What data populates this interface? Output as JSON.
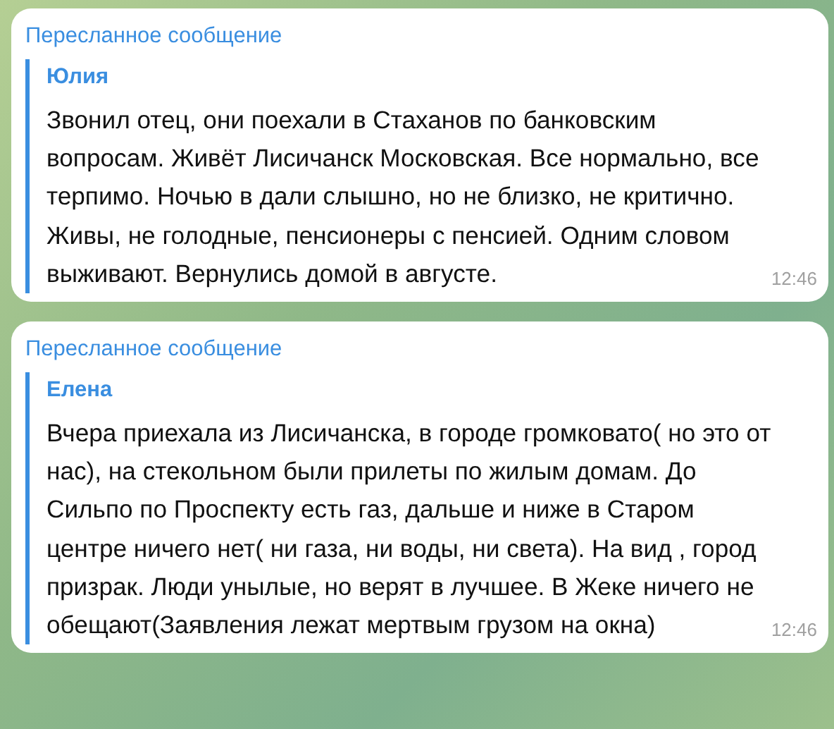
{
  "messages": [
    {
      "forwarded_label": "Пересланное сообщение",
      "sender": "Юлия",
      "text": "Звонил отец, они поехали в Стаханов по банковским вопросам. Живёт Лисичанск Московская. Все нормально, все терпимо. Ночью в дали слышно, но не близко, не критично. Живы, не голодные, пенсионеры с пенсией. Одним словом выживают. Вернулись домой в августе.",
      "time": "12:46"
    },
    {
      "forwarded_label": "Пересланное сообщение",
      "sender": "Елена",
      "text": "Вчера приехала из Лисичанска, в городе громковато( но это от нас), на стекольном были прилеты по жилым домам. До Сильпо по Проспекту есть газ, дальше и ниже в Старом  центре ничего нет( ни газа, ни воды, ни света). На вид , город призрак. Люди унылые, но верят в лучшее. В Жеке ничего не обещают(Заявления лежат мертвым грузом на окна)",
      "time": "12:46"
    }
  ]
}
